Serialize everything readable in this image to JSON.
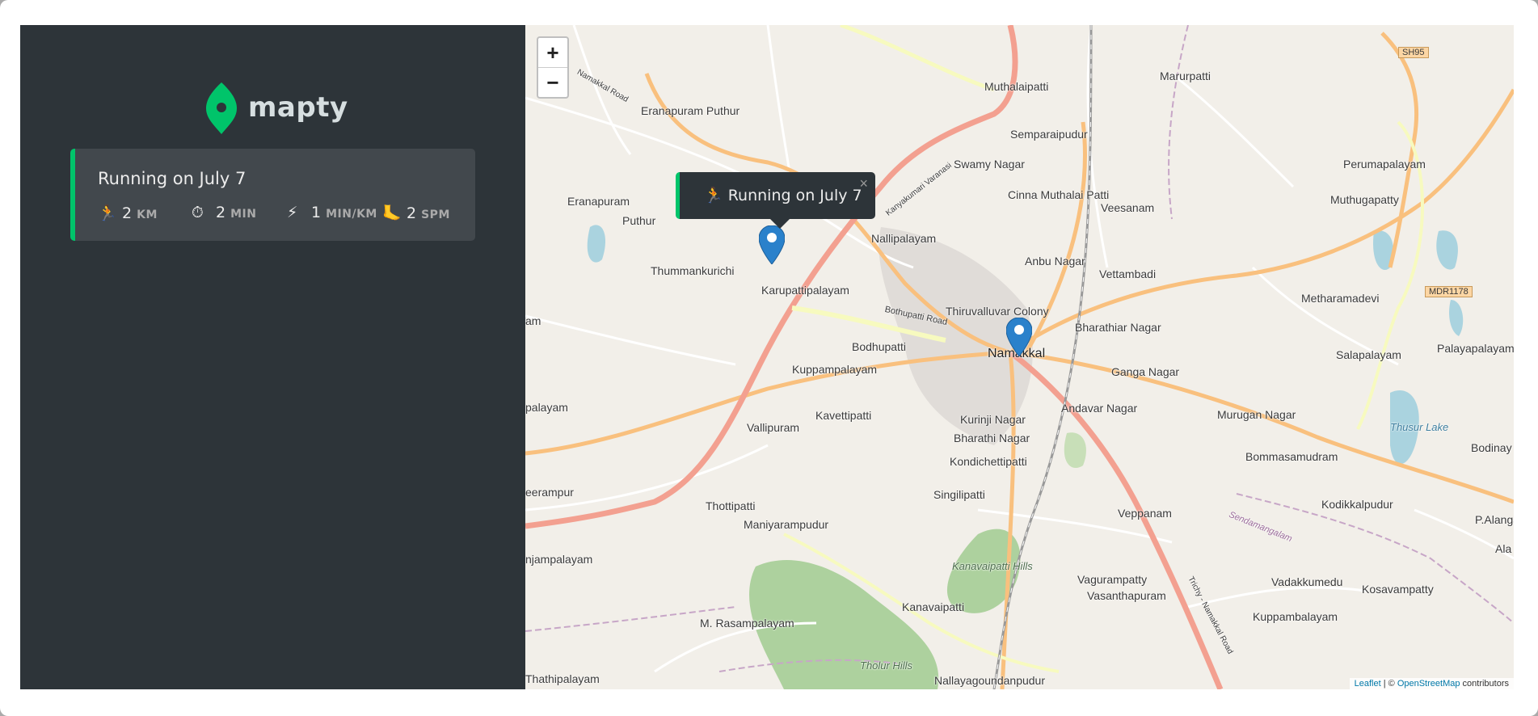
{
  "app": {
    "name": "mapty"
  },
  "workout": {
    "title": "Running on July 7",
    "stats": [
      {
        "icon": "running-icon",
        "glyph": "🏃",
        "value": "2",
        "unit": "KM"
      },
      {
        "icon": "stopwatch-icon",
        "glyph": "⏱",
        "value": "2",
        "unit": "MIN"
      },
      {
        "icon": "lightning-icon",
        "glyph": "⚡",
        "value": "1",
        "unit": "MIN/KM"
      },
      {
        "icon": "footprint-icon",
        "glyph": "🦶",
        "value": "2",
        "unit": "SPM"
      }
    ]
  },
  "map": {
    "zoom_in": "+",
    "zoom_out": "−",
    "popup": {
      "text": "🏃 Running on July 7",
      "close": "×"
    },
    "attribution": {
      "leaflet": "Leaflet",
      "sep": " | © ",
      "osm": "OpenStreetMap",
      "suffix": " contributors"
    },
    "places": [
      "Eranapuram Puthur",
      "Muthalaipatti",
      "Marurpatti",
      "Semparaipudur",
      "Swamy Nagar",
      "Cinna Muthalai Patti",
      "Eranapuram",
      "Puthur",
      "Veesanam",
      "Perumapalayam",
      "Muthugapatty",
      "Nallipalayam",
      "Anbu Nagar",
      "Thummankurichi",
      "Karupattipalayam",
      "Vettambadi",
      "Metharamadevi",
      "Thiruvalluvar Colony",
      "Bharathiar Nagar",
      "Namakkal",
      "Bodhupatti",
      "Ganga Nagar",
      "Salapalayam",
      "Palayapalayam",
      "Kuppampalayam",
      "Andavar Nagar",
      "Murugan Nagar",
      "Vallipuram",
      "Kavettipatti",
      "Kurinji Nagar",
      "Bharathi Nagar",
      "Kondichettipatti",
      "Bommasamudram",
      "Bodinay",
      "Singilipatti",
      "Thottipatti",
      "Veppanam",
      "Kodikkalpudur",
      "P.Alangar",
      "Maniyarampudur",
      "Vagurampatty",
      "Vasanthapuram",
      "Vadakkumedu",
      "Kosavampatty",
      "Kanavaipatti",
      "Kuppambalayam",
      "M. Rasampalayam",
      "Thathipalayam",
      "Nallayagoundanpudur",
      "eerampur",
      "njampalayam",
      "palayam",
      "am",
      "Ala"
    ],
    "road_labels": [
      "Bothupatti Road",
      "SH95",
      "MDR1178",
      "Kanyakumari Varanasi",
      "Trichy - Namakkal Road",
      "Sendamangalam",
      "Namakkal Road"
    ],
    "area_labels": [
      "Kanavaipatti Hills",
      "Tholur Hills",
      "Thusur Lake"
    ]
  }
}
